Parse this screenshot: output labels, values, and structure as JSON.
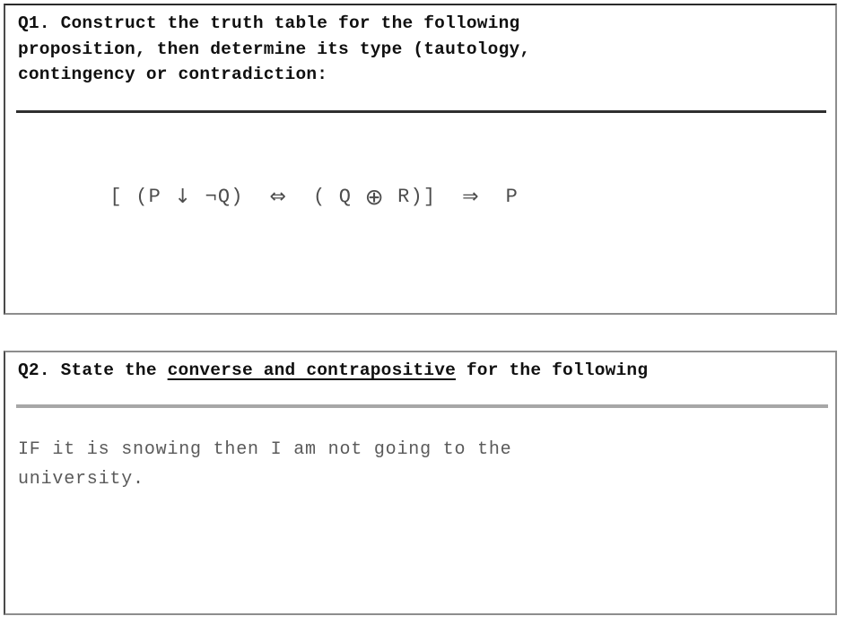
{
  "document": {
    "kind": "worksheet-scan",
    "background_color": "#ffffff",
    "ink_color": "#101010"
  },
  "questions": [
    {
      "id": "q1",
      "prompt": "Q1. Construct the truth table for the following\nproposition, then determine its type (tautology,\ncontingency or contradiction:",
      "divider_color": "#2f2f2f",
      "formula": {
        "full_text": "[ (P ↓ ¬Q)  ⇔  ( Q ⊕ R)]  ⇒  P",
        "segments": [
          {
            "text": "[ (P ",
            "type": "plain"
          },
          {
            "text": "↓",
            "type": "operator",
            "name": "nor-down-arrow"
          },
          {
            "text": " ¬Q)  ",
            "type": "plain"
          },
          {
            "text": "⇔",
            "type": "operator",
            "name": "biconditional"
          },
          {
            "text": "  ( Q ",
            "type": "plain"
          },
          {
            "text": "⊕",
            "type": "operator-xor",
            "name": "exclusive-or"
          },
          {
            "text": " R)]  ",
            "type": "plain"
          },
          {
            "text": "⇒",
            "type": "operator",
            "name": "implies"
          },
          {
            "text": "  P",
            "type": "plain"
          }
        ],
        "color": "#4d4d4d"
      }
    },
    {
      "id": "q2",
      "prompt_before": "Q2. State the ",
      "prompt_underlined": "converse and contrapositive",
      "prompt_after": " for the following",
      "divider_color": "#a7a7a7",
      "statement": "IF it is snowing then I am not going to the\nuniversity.",
      "statement_color": "#5a5a5a"
    }
  ]
}
